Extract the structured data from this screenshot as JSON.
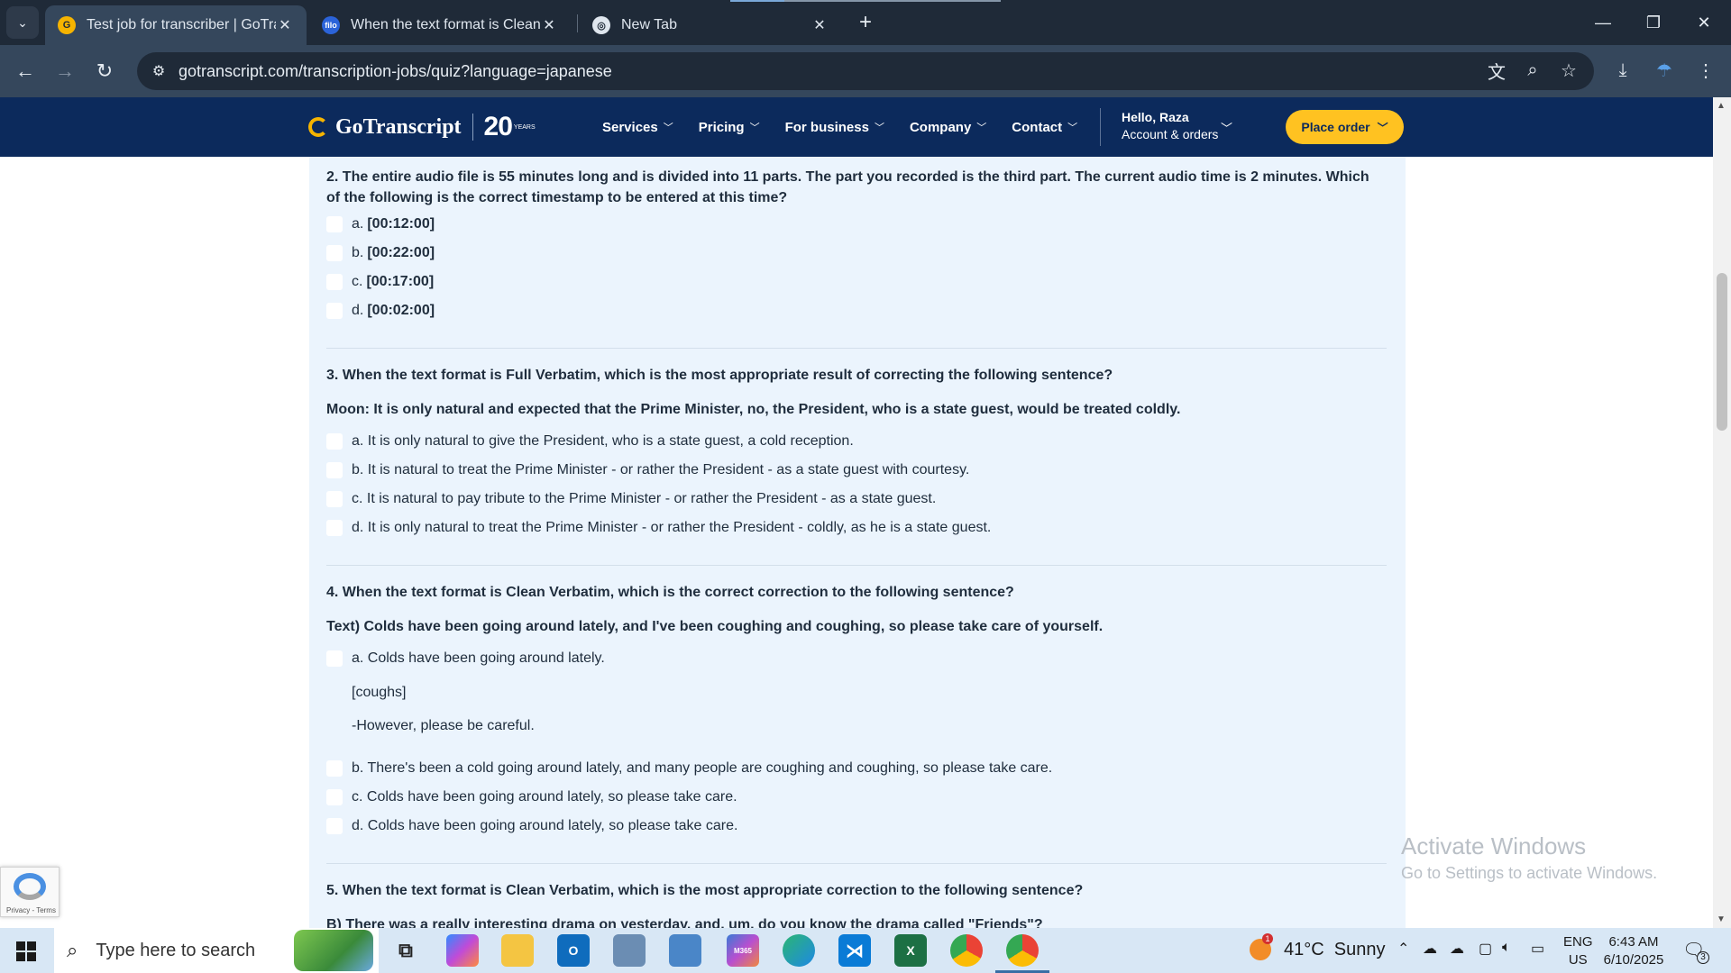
{
  "browser": {
    "tabs": [
      {
        "title": "Test job for transcriber | GoTran",
        "active": true
      },
      {
        "title": "When the text format is Clean V",
        "active": false
      },
      {
        "title": "New Tab",
        "active": false
      }
    ],
    "url": "gotranscript.com/transcription-jobs/quiz?language=japanese",
    "icons": {
      "back": "back-arrow-icon",
      "forward": "forward-arrow-icon",
      "reload": "reload-icon",
      "site_info": "tune-icon",
      "translate": "translate-icon",
      "zoom": "zoom-icon",
      "bookmark": "star-icon",
      "download": "download-icon",
      "profile": "profile-icon",
      "menu": "kebab-menu-icon"
    }
  },
  "header": {
    "brand": "GoTranscript",
    "anniversary": "20",
    "anniversary_sub": "YEARS",
    "nav": [
      "Services",
      "Pricing",
      "For business",
      "Company",
      "Contact"
    ],
    "greeting": "Hello, Raza",
    "account_label": "Account & orders",
    "cta": "Place order",
    "colors": {
      "bar": "#0c2a5c",
      "cta": "#ffc221",
      "accent": "#f6b400"
    }
  },
  "quiz": {
    "q2": {
      "text": "2. The entire audio file is 55 minutes long and is divided into 11 parts. The part you recorded is the third part. The current audio time is 2 minutes. Which of the following is the correct timestamp to be entered at this time?",
      "options": [
        {
          "letter": "a.",
          "text": "[00:12:00]"
        },
        {
          "letter": "b.",
          "text": "[00:22:00]"
        },
        {
          "letter": "c.",
          "text": "[00:17:00]"
        },
        {
          "letter": "d.",
          "text": "[00:02:00]"
        }
      ]
    },
    "q3": {
      "text": "3. When the text format is Full Verbatim, which is the most appropriate result of correcting the following sentence?",
      "prompt": "Moon: It is only natural and expected that the Prime Minister, no, the President, who is a state guest, would be treated coldly.",
      "options": [
        "a. It is only natural to give the President, who is a state guest, a cold reception.",
        "b. It is natural to treat the Prime Minister - or rather the President - as a state guest with courtesy.",
        "c. It is natural to pay tribute to the Prime Minister - or rather the President - as a state guest.",
        "d. It is only natural to treat the Prime Minister - or rather the President - coldly, as he is a state guest."
      ]
    },
    "q4": {
      "text": "4. When the text format is Clean Verbatim, which is the correct correction to the following sentence?",
      "prompt": "Text) Colds have been going around lately, and I've been coughing and coughing, so please take care of yourself.",
      "option_a": "a. Colds have been going around lately.",
      "option_a_line2": "[coughs]",
      "option_a_line3": "-However, please be careful.",
      "options": [
        "b. There's been a cold going around lately, and many people are coughing and coughing, so please take care.",
        "c. Colds have been going around lately, so please take care.",
        "d. Colds have been going around lately, so please take care."
      ]
    },
    "q5": {
      "text": "5. When the text format is Clean Verbatim, which is the most appropriate correction to the following sentence?",
      "prompt": "B) There was a really interesting drama on yesterday, and, um, do you know the drama called \"Friends\"?"
    }
  },
  "recaptcha": {
    "terms": "Privacy - Terms"
  },
  "watermark": {
    "title": "Activate Windows",
    "subtitle": "Go to Settings to activate Windows."
  },
  "taskbar": {
    "search_placeholder": "Type here to search",
    "weather": "41°C  Sunny",
    "weather_badge": "1",
    "lang_top": "ENG",
    "lang_bottom": "US",
    "time": "6:43 AM",
    "date": "6/10/2025",
    "notifications": "3",
    "apps": [
      "task-view-icon",
      "copilot-icon",
      "file-explorer-icon",
      "outlook-icon",
      "network-app-icon",
      "computer-app-icon",
      "m365-icon",
      "edge-icon",
      "vscode-icon",
      "excel-icon",
      "chrome-icon",
      "chrome-profile-icon"
    ]
  }
}
